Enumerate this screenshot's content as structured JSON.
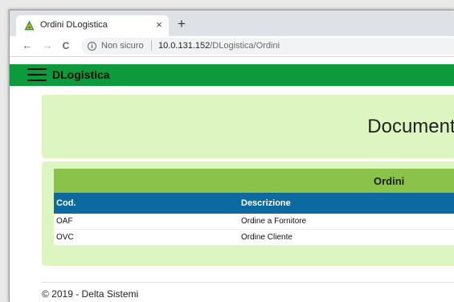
{
  "browser": {
    "tab_title": "Ordini DLogistica",
    "tab_close": "×",
    "new_tab": "+",
    "back": "←",
    "forward": "→",
    "reload": "C",
    "info": "i",
    "security_label": "Non sicuro",
    "url_host": "10.0.131.152",
    "url_path": "/DLogistica/Ordini"
  },
  "app": {
    "brand": "DLogistica",
    "accent_color": "#0c9a3c"
  },
  "page": {
    "title": "Documenti"
  },
  "table": {
    "caption": "Ordini",
    "columns": [
      "Cod.",
      "Descrizione"
    ],
    "rows": [
      [
        "OAF",
        "Ordine a Fornitore"
      ],
      [
        "OVC",
        "Ordine Cliente"
      ]
    ]
  },
  "footer": {
    "text": "© 2019 - Delta Sistemi"
  }
}
